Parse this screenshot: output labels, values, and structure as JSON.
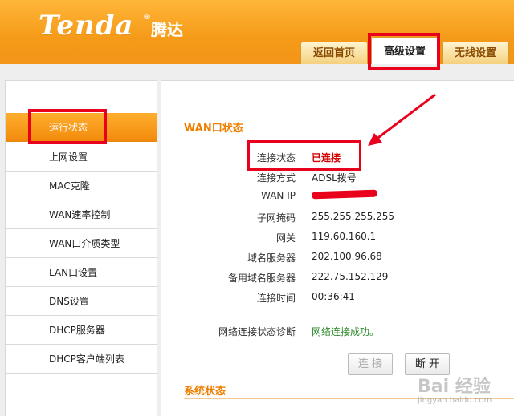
{
  "header": {
    "logo_en": "Tenda",
    "logo_cn": "腾达",
    "registered": "®",
    "tabs": [
      {
        "label": "返回首页",
        "active": false
      },
      {
        "label": "高级设置",
        "active": true
      },
      {
        "label": "无线设置",
        "active": false
      }
    ],
    "brand_color": "#f59a18"
  },
  "sidebar": {
    "items": [
      {
        "label": "运行状态",
        "active": true
      },
      {
        "label": "上网设置",
        "active": false
      },
      {
        "label": "MAC克隆",
        "active": false
      },
      {
        "label": "WAN速率控制",
        "active": false
      },
      {
        "label": "WAN口介质类型",
        "active": false
      },
      {
        "label": "LAN口设置",
        "active": false
      },
      {
        "label": "DNS设置",
        "active": false
      },
      {
        "label": "DHCP服务器",
        "active": false
      },
      {
        "label": "DHCP客户端列表",
        "active": false
      }
    ]
  },
  "wan": {
    "title": "WAN口状态",
    "rows": [
      {
        "label": "连接状态",
        "value": "已连接"
      },
      {
        "label": "连接方式",
        "value": "ADSL拨号"
      },
      {
        "label": "WAN IP",
        "value": ""
      },
      {
        "label": "子网掩码",
        "value": "255.255.255.255"
      },
      {
        "label": "网关",
        "value": "119.60.160.1"
      },
      {
        "label": "域名服务器",
        "value": "202.100.96.68"
      },
      {
        "label": "备用域名服务器",
        "value": "222.75.152.129"
      },
      {
        "label": "连接时间",
        "value": "00:36:41"
      }
    ],
    "diag_label": "网络连接状态诊断",
    "diag_value": "网络连接成功。",
    "connect_button": "连 接",
    "disconnect_button": "断 开"
  },
  "system": {
    "title": "系统状态"
  },
  "watermark": {
    "text": "Bai 经验",
    "sub": "jingyan.baidu.com"
  }
}
